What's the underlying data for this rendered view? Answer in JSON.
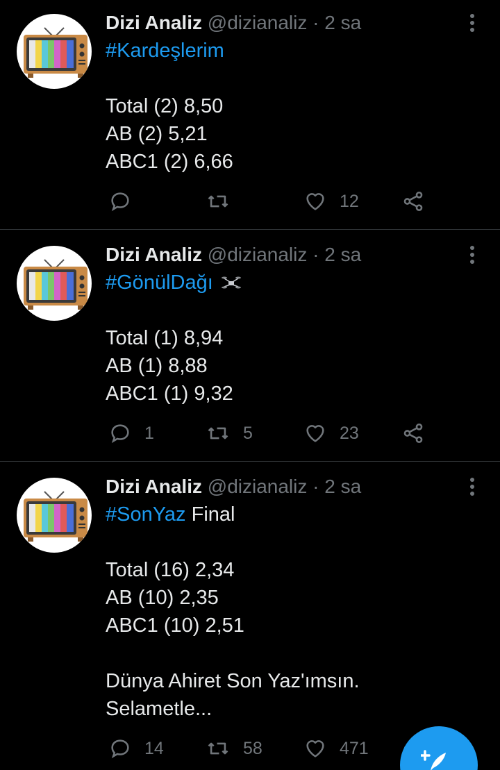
{
  "colors": {
    "background": "#000000",
    "accent": "#1d9bf0",
    "text": "#e7e9ea",
    "muted": "#71767b",
    "divider": "#2f3336"
  },
  "tweets": [
    {
      "name": "Dizi Analiz",
      "handle": "@dizianaliz",
      "separator": "·",
      "time": "2 sa",
      "hashtag": "#Kardeşlerim",
      "title_suffix": "",
      "lines": [
        "Total (2) 8,50",
        "AB (2) 5,21",
        "ABC1 (2) 6,66"
      ],
      "extra_lines": [],
      "replies": "",
      "retweets": "",
      "likes": "12"
    },
    {
      "name": "Dizi Analiz",
      "handle": "@dizianaliz",
      "separator": "·",
      "time": "2 sa",
      "hashtag": "#GönülDağı",
      "title_suffix": "",
      "title_icon": "drone-emoji-icon",
      "lines": [
        "Total (1) 8,94",
        "AB (1) 8,88",
        "ABC1 (1) 9,32"
      ],
      "extra_lines": [],
      "replies": "1",
      "retweets": "5",
      "likes": "23"
    },
    {
      "name": "Dizi Analiz",
      "handle": "@dizianaliz",
      "separator": "·",
      "time": "2 sa",
      "hashtag": "#SonYaz",
      "title_suffix": "Final",
      "lines": [
        "Total (16) 2,34",
        "AB (10) 2,35",
        "ABC1 (10) 2,51"
      ],
      "extra_lines": [
        "Dünya Ahiret Son Yaz'ımsın.",
        "Selametle..."
      ],
      "replies": "14",
      "retweets": "58",
      "likes": "471"
    }
  ],
  "icons": {
    "reply": "reply-icon",
    "retweet": "retweet-icon",
    "like": "heart-icon",
    "share": "share-icon",
    "more": "more-options-icon",
    "compose": "compose-tweet-icon"
  }
}
